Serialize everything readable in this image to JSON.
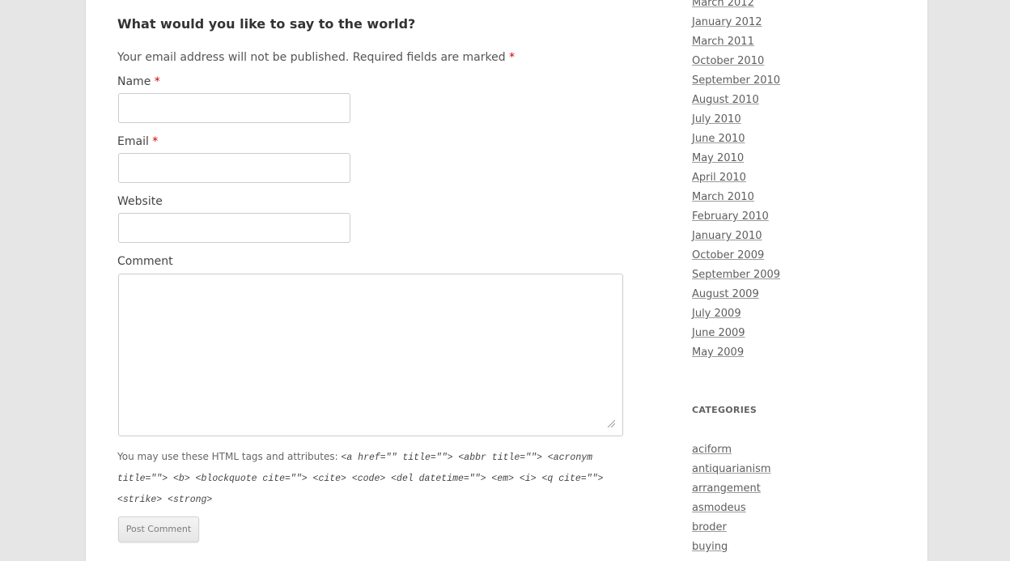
{
  "comment_form": {
    "title": "What would you like to say to the world?",
    "notes": "Your email address will not be published. Required fields are marked",
    "required_marker": "*",
    "fields": {
      "name_label": "Name",
      "email_label": "Email",
      "website_label": "Website",
      "comment_label": "Comment"
    },
    "allowed_tags_intro": "You may use these HTML tags and attributes:",
    "allowed_tags": "<a href=\"\" title=\"\"> <abbr title=\"\"> <acronym title=\"\"> <b> <blockquote cite=\"\"> <cite> <code> <del datetime=\"\"> <em> <i> <q cite=\"\"> <strike> <strong>",
    "submit_label": "Post Comment"
  },
  "sidebar": {
    "archives": [
      "March 2012",
      "January 2012",
      "March 2011",
      "October 2010",
      "September 2010",
      "August 2010",
      "July 2010",
      "June 2010",
      "May 2010",
      "April 2010",
      "March 2010",
      "February 2010",
      "January 2010",
      "October 2009",
      "September 2009",
      "August 2009",
      "July 2009",
      "June 2009",
      "May 2009"
    ],
    "categories_title": "CATEGORIES",
    "categories": [
      "aciform",
      "antiquarianism",
      "arrangement",
      "asmodeus",
      "broder",
      "buying"
    ]
  },
  "colors": {
    "background": "#e6e6e6",
    "page": "#ffffff",
    "required": "#cc0000",
    "link": "#5e5e5e"
  }
}
